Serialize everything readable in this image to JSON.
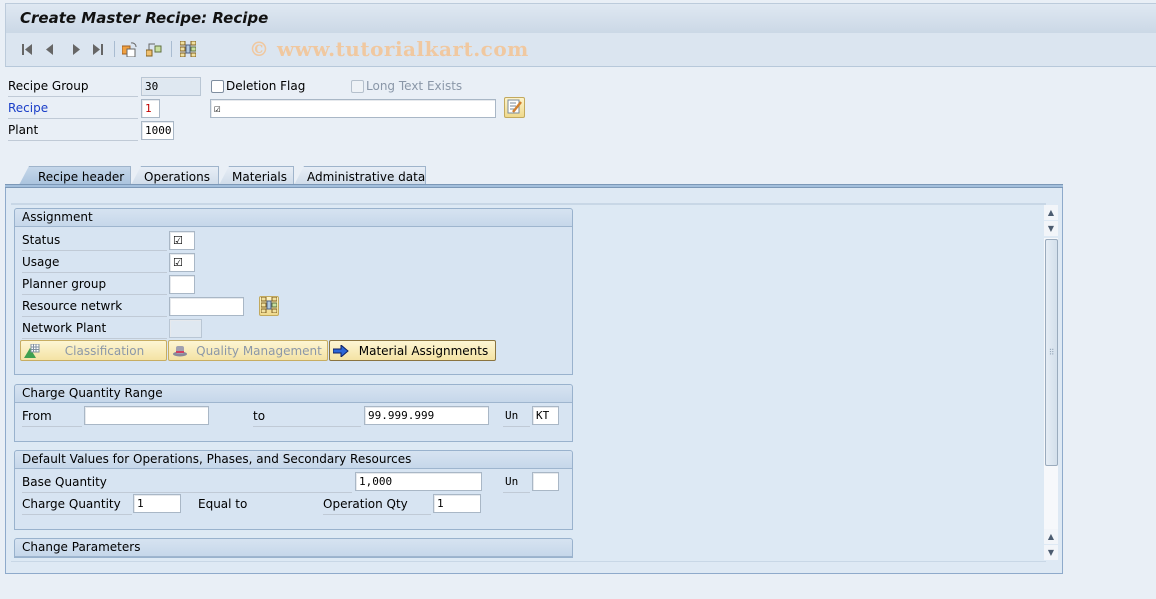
{
  "window": {
    "title": "Create Master Recipe: Recipe",
    "watermark": "© www.tutorialkart.com"
  },
  "toolbar": {
    "buttons": [
      {
        "name": "first-record",
        "icon": "first-icon"
      },
      {
        "name": "previous-record",
        "icon": "previous-icon"
      },
      {
        "name": "next-record",
        "icon": "next-icon"
      },
      {
        "name": "last-record",
        "icon": "last-icon"
      },
      {
        "name": "other-recipe",
        "icon": "copy-refresh-icon"
      },
      {
        "name": "sequence",
        "icon": "hierarchy-icon"
      },
      {
        "name": "resource-network",
        "icon": "network-icon"
      }
    ]
  },
  "header": {
    "recipe_group": {
      "label": "Recipe Group",
      "value": "30"
    },
    "deletion_flag": {
      "label": "Deletion Flag",
      "checked": false
    },
    "long_text_exists": {
      "label": "Long Text Exists",
      "checked": false,
      "disabled": true
    },
    "recipe": {
      "label": "Recipe",
      "value": "1",
      "description_value": "☑",
      "description_glyph": "☑"
    },
    "plant": {
      "label": "Plant",
      "value": "1000"
    }
  },
  "tabs": [
    {
      "label": "Recipe header",
      "active": true
    },
    {
      "label": "Operations",
      "active": false
    },
    {
      "label": "Materials",
      "active": false
    },
    {
      "label": "Administrative data",
      "active": false
    }
  ],
  "assignment": {
    "title": "Assignment",
    "status": {
      "label": "Status",
      "value": "☑"
    },
    "usage": {
      "label": "Usage",
      "value": "☑"
    },
    "planner_group": {
      "label": "Planner group",
      "value": ""
    },
    "resource_network": {
      "label": "Resource netwrk",
      "value": ""
    },
    "network_plant": {
      "label": "Network Plant",
      "value": ""
    },
    "buttons": {
      "classification": "Classification",
      "quality_management": "Quality Management",
      "material_assignments": "Material Assignments"
    }
  },
  "charge_range": {
    "title": "Charge Quantity Range",
    "from_label": "From",
    "from_value": "",
    "to_label": "to",
    "to_value": "99.999.999",
    "unit_label": "Un",
    "unit_value": "KT"
  },
  "defaults": {
    "title": "Default Values for Operations, Phases, and Secondary Resources",
    "base_qty_label": "Base Quantity",
    "base_qty_value": "1,000",
    "unit_label": "Un",
    "unit_value": "",
    "charge_qty_label": "Charge Quantity",
    "charge_qty_value": "1",
    "equal_to_label": "Equal to",
    "operation_qty_label": "Operation Qty",
    "operation_qty_value": "1"
  },
  "change_params": {
    "title": "Change Parameters"
  },
  "scrollbar": {
    "position_fraction": 0.0
  }
}
